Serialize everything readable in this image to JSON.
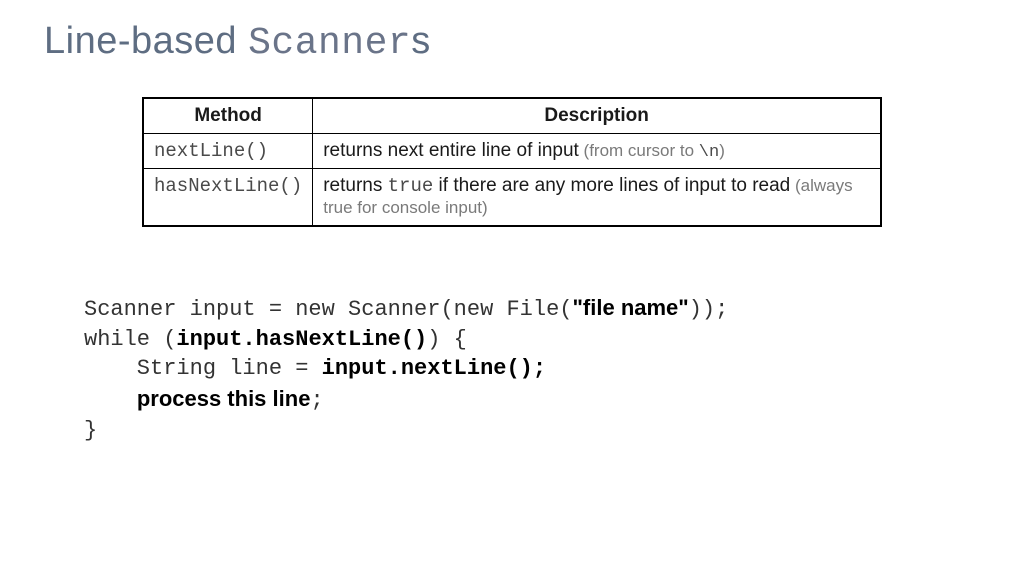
{
  "title": {
    "prefix": "Line-based ",
    "mono": "Scanner",
    "suffix": "s"
  },
  "table": {
    "head": {
      "method": "Method",
      "desc": "Description"
    },
    "rows": [
      {
        "method": "nextLine()",
        "desc_main": "returns next entire line of input",
        "note_prefix": "  (from cursor to ",
        "note_mono": "\\n",
        "note_suffix": ")"
      },
      {
        "method": "hasNextLine()",
        "desc_pre": "returns ",
        "desc_mono": "true",
        "desc_post": " if there are any more lines of input to read",
        "note": "   (always true for console input)"
      }
    ]
  },
  "code": {
    "l1a": "Scanner input = new Scanner(new File(",
    "l1b": "\"file name\"",
    "l1c": "));",
    "l2a": "while (",
    "l2b": "input.hasNextLine()",
    "l2c": ") {",
    "l3a": "    String line = ",
    "l3b": "input.nextLine();",
    "l4a": "    ",
    "l4b": "process this line",
    "l4c": ";",
    "l5": "}"
  }
}
